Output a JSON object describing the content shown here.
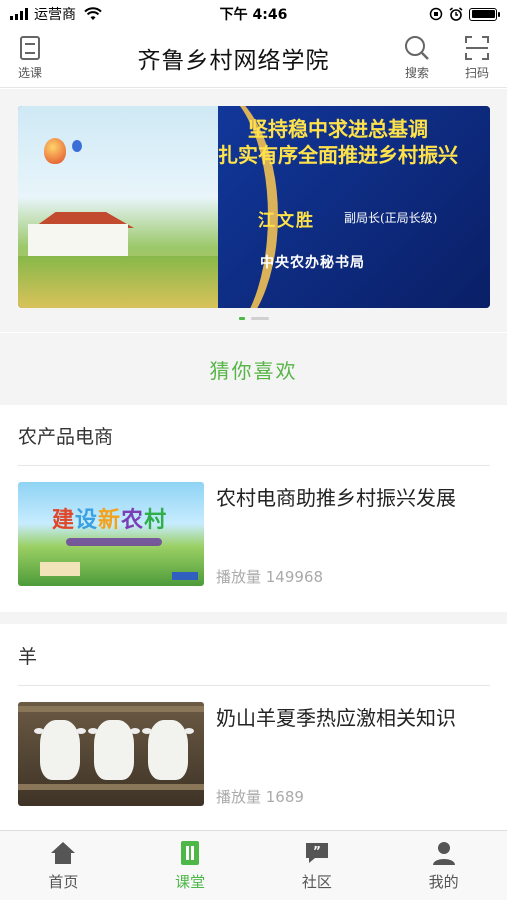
{
  "status_bar": {
    "carrier": "运营商",
    "time": "下午 4:46",
    "battery_level": 1.0
  },
  "header": {
    "title": "齐鲁乡村网络学院",
    "left_button": {
      "label": "选课",
      "icon": "book-icon"
    },
    "right_buttons": [
      {
        "label": "搜索",
        "icon": "search-icon"
      },
      {
        "label": "扫码",
        "icon": "scan-icon"
      }
    ]
  },
  "banner": {
    "title_line1": "坚持稳中求进总基调",
    "title_line2": "扎实有序全面推进乡村振兴",
    "speaker_name": "江文胜",
    "speaker_position": "副局长(正局长级)",
    "organization": "中央农办秘书局",
    "slide_count": 2,
    "active_slide": 1
  },
  "recommend": {
    "title": "猜你喜欢"
  },
  "sections": [
    {
      "title": "农产品电商",
      "course": {
        "title": "农村电商助推乡村振兴发展",
        "views": "播放量 149968",
        "thumb_text": "建设新农村"
      }
    },
    {
      "title": "羊",
      "course": {
        "title": "奶山羊夏季热应激相关知识",
        "views": "播放量 1689"
      }
    }
  ],
  "tabbar": {
    "items": [
      {
        "label": "首页",
        "icon": "home-icon",
        "active": false
      },
      {
        "label": "课堂",
        "icon": "classroom-icon",
        "active": true
      },
      {
        "label": "社区",
        "icon": "community-icon",
        "active": false
      },
      {
        "label": "我的",
        "icon": "profile-icon",
        "active": false
      }
    ]
  },
  "colors": {
    "accent": "#4db848",
    "banner_navy": "#0e2a7a",
    "banner_gold": "#ffe24a"
  }
}
